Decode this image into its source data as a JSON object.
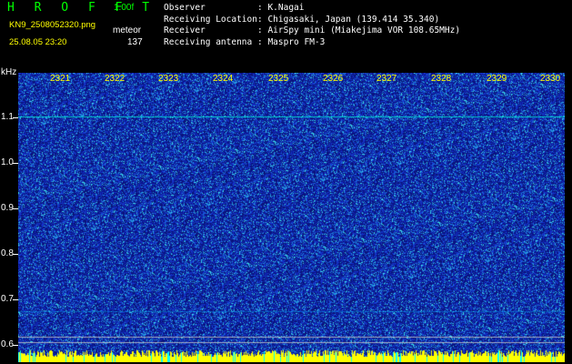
{
  "header": {
    "brand": "H R O F F T",
    "version": "1.00f",
    "filename": "KN9_2508052320.png",
    "mode": "meteor",
    "datetime": "25.08.05 23:20",
    "count": "137"
  },
  "info": {
    "labels": [
      "Observer",
      "Receiving Location",
      "Receiver",
      "Receiving antenna"
    ],
    "values": [
      ": K.Nagai",
      ": Chigasaki, Japan (139.414 35.340)",
      ": AirSpy mini (Miakejima VOR 108.65MHz)",
      ": Maspro FM-3"
    ]
  },
  "axis": {
    "unit": "kHz",
    "y_ticks": [
      "1.1",
      "1.0",
      "0.9",
      "0.8",
      "0.7",
      "0.6"
    ],
    "x_ticks": [
      "2321",
      "2322",
      "2323",
      "2324",
      "2325",
      "2326",
      "2327",
      "2328",
      "2329",
      "2330"
    ]
  },
  "colors": {
    "background": "#000000",
    "text_green": "#00ff00",
    "text_white": "#ffffff",
    "text_yellow": "#ffff00",
    "spectrogram_base": "#1020a0",
    "signal": "#00ffff"
  }
}
